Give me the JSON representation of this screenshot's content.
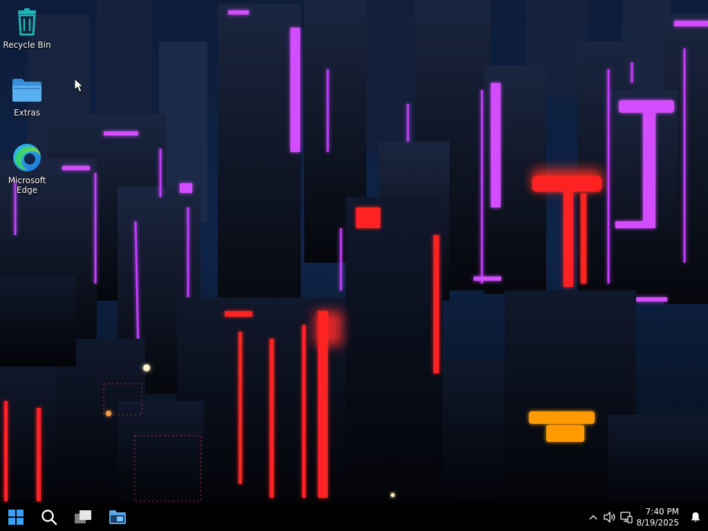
{
  "desktop": {
    "icons": [
      {
        "label": "Recycle Bin",
        "icon": "recycle-bin-icon"
      },
      {
        "label": "Extras",
        "icon": "folder-icon"
      },
      {
        "label": "Microsoft\nEdge",
        "icon": "edge-icon"
      }
    ],
    "wallpaper": "neon-city-wallpaper"
  },
  "taskbar": {
    "items": [
      {
        "name": "start",
        "icon": "windows-logo-icon"
      },
      {
        "name": "search",
        "icon": "search-icon"
      },
      {
        "name": "task-view",
        "icon": "task-view-icon"
      },
      {
        "name": "file-explorer",
        "icon": "file-explorer-icon"
      }
    ],
    "tray": {
      "overflow_icon": "chevron-up-icon",
      "volume_icon": "speaker-icon",
      "network_icon": "network-icon",
      "notification_icon": "bell-icon"
    },
    "clock": {
      "time": "7:40 PM",
      "date": "8/19/2025"
    }
  },
  "colors": {
    "taskbar_bg": "#000000",
    "neon_magenta": "#c23cff",
    "neon_red": "#ff2020",
    "neon_orange": "#ff8a00",
    "recycle_bin_teal": "#1fb5b5",
    "folder_blue": "#3a8fd9",
    "start_blue": "#3aa0ff"
  }
}
